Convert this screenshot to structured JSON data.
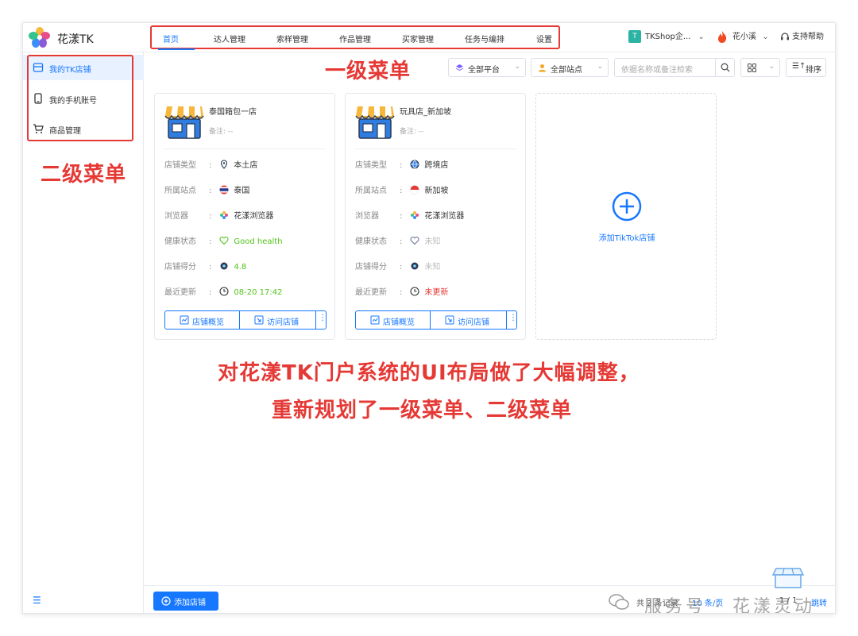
{
  "app": {
    "brand": "花漾TK"
  },
  "topnav": {
    "items": [
      {
        "label": "首页",
        "active": true
      },
      {
        "label": "达人管理"
      },
      {
        "label": "索样管理"
      },
      {
        "label": "作品管理"
      },
      {
        "label": "买家管理"
      },
      {
        "label": "任务与编排"
      },
      {
        "label": "设置"
      }
    ]
  },
  "header_right": {
    "shop_badge": "T",
    "shop_name": "TKShop企...",
    "user_name": "花小溪",
    "help_label": "支持帮助"
  },
  "sidebar": {
    "items": [
      {
        "label": "我的TK店铺",
        "active": true
      },
      {
        "label": "我的手机账号"
      },
      {
        "label": "商品管理"
      }
    ],
    "collapse_icon": "☰"
  },
  "annotations": {
    "menu_level1": "一级菜单",
    "menu_level2": "二级菜单",
    "caption_line1": "对花漾TK门户系统的UI布局做了大幅调整，",
    "caption_line2": "重新规划了一级菜单、二级菜单"
  },
  "toolbar": {
    "platform_select": "全部平台",
    "site_select": "全部站点",
    "search_placeholder": "依据名称或备注检索",
    "sort_label": "排序"
  },
  "field_labels": {
    "shop_type": "店铺类型",
    "site": "所属站点",
    "browser": "浏览器",
    "health": "健康状态",
    "score": "店铺得分",
    "updated": "最近更新"
  },
  "shops": [
    {
      "name": "泰国箱包一店",
      "note": "备注: --",
      "shop_type": "本土店",
      "site": "泰国",
      "browser": "花漾浏览器",
      "health": "Good health",
      "score": "4.8",
      "updated": "08-20 17:42",
      "btn_overview": "店铺概览",
      "btn_visit": "访问店铺"
    },
    {
      "name": "玩具店_新加坡",
      "note": "备注: --",
      "shop_type": "跨境店",
      "site": "新加坡",
      "browser": "花漾浏览器",
      "health": "未知",
      "score": "未知",
      "updated": "未更新",
      "btn_overview": "店铺概览",
      "btn_visit": "访问店铺"
    }
  ],
  "add_card": {
    "label": "添加TikTok店铺"
  },
  "bottom": {
    "add_button": "添加店铺",
    "total": "共 2 条记录",
    "page_size": "10 条/页",
    "page": "1 / 1",
    "jump": "跳转",
    "watermark": "服务号 · 花漾灵动"
  },
  "colors": {
    "accent": "#1677ff",
    "annotation": "#e53935",
    "good": "#52c41a"
  }
}
